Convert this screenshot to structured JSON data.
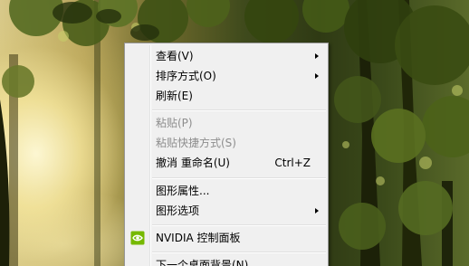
{
  "context_menu": {
    "items": [
      {
        "label": "查看(V)",
        "submenu": true
      },
      {
        "label": "排序方式(O)",
        "submenu": true
      },
      {
        "label": "刷新(E)"
      },
      {
        "label": "粘贴(P)",
        "disabled": true
      },
      {
        "label": "粘贴快捷方式(S)",
        "disabled": true
      },
      {
        "label": "撤消 重命名(U)",
        "shortcut": "Ctrl+Z"
      },
      {
        "label": "图形属性..."
      },
      {
        "label": "图形选项",
        "submenu": true
      },
      {
        "label": "NVIDIA 控制面板",
        "icon": "nvidia-icon"
      },
      {
        "label": "下一个桌面背景(N)"
      }
    ]
  },
  "colors": {
    "menu_background": "#f0f0f0",
    "disabled_text": "#8d8d8d",
    "nvidia_green": "#76b900"
  }
}
